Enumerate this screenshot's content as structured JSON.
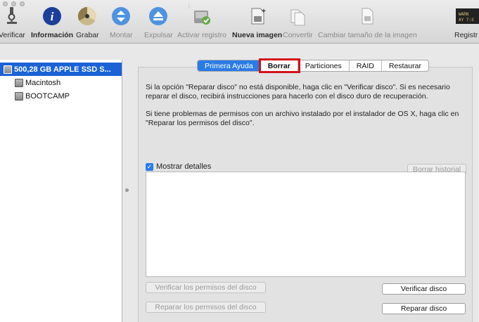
{
  "toolbar": {
    "items": [
      {
        "label": "Verificar",
        "icon": "microscope-icon",
        "state": "normal"
      },
      {
        "label": "Información",
        "icon": "info-icon",
        "state": "bold"
      },
      {
        "label": "Grabar",
        "icon": "burn-icon",
        "state": "normal"
      },
      {
        "label": "Montar",
        "icon": "mount-icon",
        "state": "normal"
      },
      {
        "label": "Expulsar",
        "icon": "eject-icon",
        "state": "normal"
      },
      {
        "label": "Activar registro",
        "icon": "log-icon",
        "state": "normal"
      },
      {
        "label": "Nueva imagen",
        "icon": "new-image-icon",
        "state": "bold"
      },
      {
        "label": "Convertir",
        "icon": "convert-icon",
        "state": "dim"
      },
      {
        "label": "Cambiar tamaño de la imagen",
        "icon": "resize-image-icon",
        "state": "dim"
      },
      {
        "label": "Registr",
        "icon": "console-icon",
        "state": "normal"
      }
    ]
  },
  "sidebar": {
    "items": [
      {
        "label": "500,28 GB APPLE SSD S...",
        "selected": true
      },
      {
        "label": "Macintosh",
        "selected": false
      },
      {
        "label": "BOOTCAMP",
        "selected": false
      }
    ]
  },
  "tabs": [
    {
      "label": "Primera Ayuda",
      "active": true
    },
    {
      "label": "Borrar",
      "active": false,
      "highlight": true
    },
    {
      "label": "Particiones",
      "active": false
    },
    {
      "label": "RAID",
      "active": false
    },
    {
      "label": "Restaurar",
      "active": false
    }
  ],
  "main": {
    "paragraph1": "Si la opción \"Reparar disco\" no está disponible, haga clic en \"Verificar disco\". Si es necesario reparar el disco, recibirá instrucciones para hacerlo con el disco duro de recuperación.",
    "paragraph2": "Si tiene problemas de permisos con un archivo instalado por el instalador de OS X, haga clic en \"Reparar los permisos del disco\".",
    "show_details_label": "Mostrar detalles",
    "show_details_checked": true,
    "clear_history_label": "Borrar historial",
    "verify_permissions_label": "Verificar los permisos del disco",
    "repair_permissions_label": "Reparar los permisos del disco",
    "verify_disk_label": "Verificar disco",
    "repair_disk_label": "Reparar disco"
  },
  "colors": {
    "accent": "#2a7be6",
    "selection": "#1a62d6",
    "highlight_box": "#d4111a"
  }
}
